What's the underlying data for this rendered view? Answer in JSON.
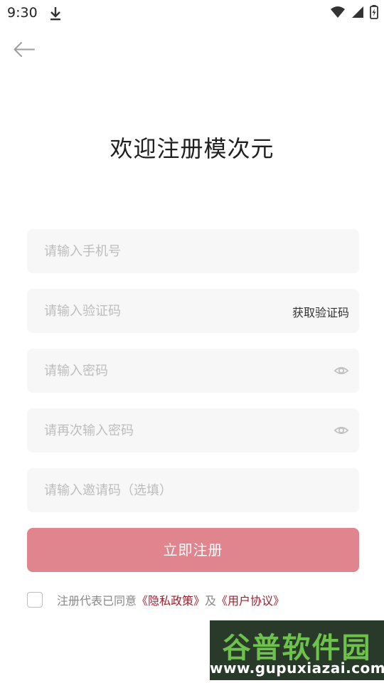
{
  "status_bar": {
    "time": "9:30",
    "icons": [
      "download-icon",
      "wifi-icon",
      "signal-icon",
      "battery-icon"
    ]
  },
  "nav": {
    "back_icon": "arrow-left-icon"
  },
  "page_title": "欢迎注册模次元",
  "form": {
    "phone_placeholder": "请输入手机号",
    "code_placeholder": "请输入验证码",
    "get_code_label": "获取验证码",
    "password_placeholder": "请输入密码",
    "confirm_password_placeholder": "请再次输入密码",
    "invite_placeholder": "请输入邀请码（选填）",
    "eye_icon": "eye-icon"
  },
  "submit_label": "立即注册",
  "agreement": {
    "prefix": "注册代表已同意",
    "privacy_link": "《隐私政策》",
    "conjunction": "及",
    "terms_link": "《用户协议》"
  },
  "watermark": {
    "brand": "谷普软件园",
    "url": "www.gupuxiazai.com"
  },
  "colors": {
    "accent": "#e0858e",
    "link": "#a01f2e",
    "field_bg": "#f7f7f7",
    "placeholder": "#bdbdbd"
  }
}
